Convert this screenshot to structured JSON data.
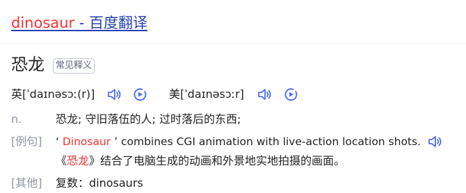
{
  "header": {
    "title_word": "dinosaur",
    "title_suffix": " - 百度翻译"
  },
  "entry": {
    "word": "恐龙",
    "badge": "常见释义"
  },
  "pronunciation": {
    "uk_label": "英",
    "uk_phonetic": "[ˈdaɪnəsɔː(r)]",
    "us_label": "美",
    "us_phonetic": "[ˈdaɪnəsɔːr]"
  },
  "definition": {
    "pos": "n.",
    "text": "恐龙; 守旧落伍的人; 过时落后的东西;"
  },
  "example": {
    "label": "[例句]",
    "quote_open": "‘ ",
    "en_highlight": "Dinosaur",
    "en_rest": " ’ combines CGI animation with live-action location shots.",
    "zh_open": "《",
    "zh_highlight": "恐龙",
    "zh_rest": "》结合了电脑生成的动画和外景地实地拍摄的画面。"
  },
  "other": {
    "label": "[其他]",
    "text": "复数：dinosaurs"
  },
  "colors": {
    "link": "#2440b3",
    "highlight": "#f73131",
    "icon": "#4e6ef2",
    "muted": "#9195a3"
  },
  "icons": [
    "speaker-icon",
    "play-circle-icon"
  ]
}
